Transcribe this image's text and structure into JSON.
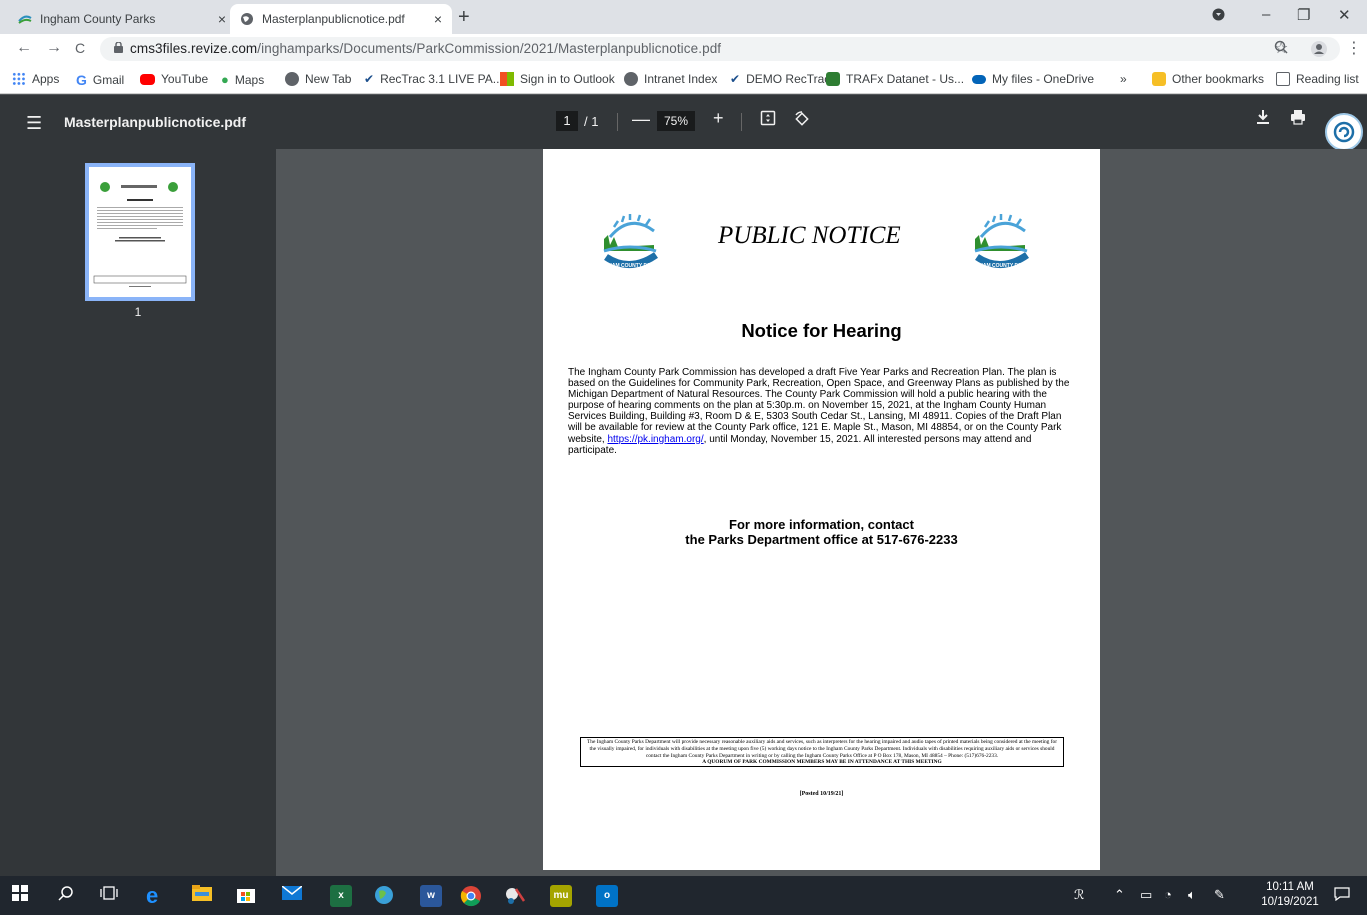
{
  "browser": {
    "tabs": [
      {
        "title": "Ingham County Parks",
        "close": "×"
      },
      {
        "title": "Masterplanpublicnotice.pdf",
        "close": "×"
      }
    ],
    "new_tab": "+",
    "window_controls": [
      "–",
      "❐",
      "✕"
    ],
    "nav": {
      "back": "←",
      "forward": "→",
      "reload": "C"
    },
    "url_host": "cms3files.revize.com",
    "url_path": "/inghamparks/Documents/ParkCommission/2021/Masterplanpublicnotice.pdf",
    "bookmarks": [
      {
        "label": "Apps",
        "color": "#1a73e8"
      },
      {
        "label": "Gmail",
        "color": "#ea4335"
      },
      {
        "label": "YouTube",
        "color": "#ff0000"
      },
      {
        "label": "Maps",
        "color": "#34a853"
      },
      {
        "label": "New Tab",
        "color": "#5f6368"
      },
      {
        "label": "RecTrac 3.1 LIVE PA...",
        "color": "#1c4f8c"
      },
      {
        "label": "Sign in to Outlook",
        "color": "#f25022"
      },
      {
        "label": "Intranet Index",
        "color": "#5f6368"
      },
      {
        "label": "DEMO RecTrac",
        "color": "#1c4f8c"
      },
      {
        "label": "TRAFx Datanet - Us...",
        "color": "#2e7d32"
      },
      {
        "label": "My files - OneDrive",
        "color": "#0364b8"
      }
    ],
    "bookmarks_more": "»",
    "other_bookmarks": "Other bookmarks",
    "reading_list": "Reading list"
  },
  "pdf_toolbar": {
    "filename": "Masterplanpublicnotice.pdf",
    "page_current": "1",
    "page_total": "/ 1",
    "zoom": "75%",
    "zoom_out": "—",
    "zoom_in": "+"
  },
  "sidebar": {
    "thumbnail_page": "1"
  },
  "document": {
    "heading": "PUBLIC NOTICE",
    "subheading": "Notice for Hearing",
    "body_before_link": "The Ingham County Park Commission has developed a draft Five Year Parks and Recreation Plan. The plan is based on the Guidelines for Community Park, Recreation, Open Space, and Greenway Plans as published by the Michigan Department of Natural Resources. The County Park Commission will hold a public hearing with the purpose of hearing comments on the plan at 5:30p.m. on November 15, 2021, at the Ingham County Human Services Building, Building #3, Room D & E, 5303 South Cedar St., Lansing, MI 48911. Copies of the Draft Plan will be available for review at the County Park office, 121 E. Maple St., Mason, MI 48854, or on the County Park website, ",
    "link": "https://pk.ingham.org/",
    "body_after_link": ", until Monday, November 15, 2021. All interested persons may attend and participate.",
    "contact_line1": "For more information, contact",
    "contact_line2": "the Parks Department office at 517-676-2233",
    "disclaimer": "The Ingham County Parks Department will provide necessary reasonable auxiliary aids and services, such as interpreters for the hearing impaired and audio tapes of printed materials being considered at the meeting for the visually impaired, for individuals with disabilities at the meeting upon five (5) working days notice to the Ingham County Parks Department. Individuals with disabilities requiring auxiliary aids or services should contact the Ingham County Parks Department in writing or by calling the Ingham County Parks Office at P O Box 178, Mason, MI 48854 – Phone: (517)676-2233.",
    "quorum": "A QUORUM OF PARK COMMISSION MEMBERS MAY BE IN ATTENDANCE AT THIS MEETING",
    "posted": "[Posted 10/19/21]",
    "logo_text": "INGHAM COUNTY PARKS"
  },
  "taskbar": {
    "apps": [
      {
        "name": "x",
        "color": "#1d6f42"
      },
      {
        "name": "w",
        "color": "#2b579a"
      },
      {
        "name": "mu",
        "color": "#a4a400"
      },
      {
        "name": "o",
        "color": "#0072c6"
      }
    ],
    "time": "10:11 AM",
    "date": "10/19/2021"
  }
}
